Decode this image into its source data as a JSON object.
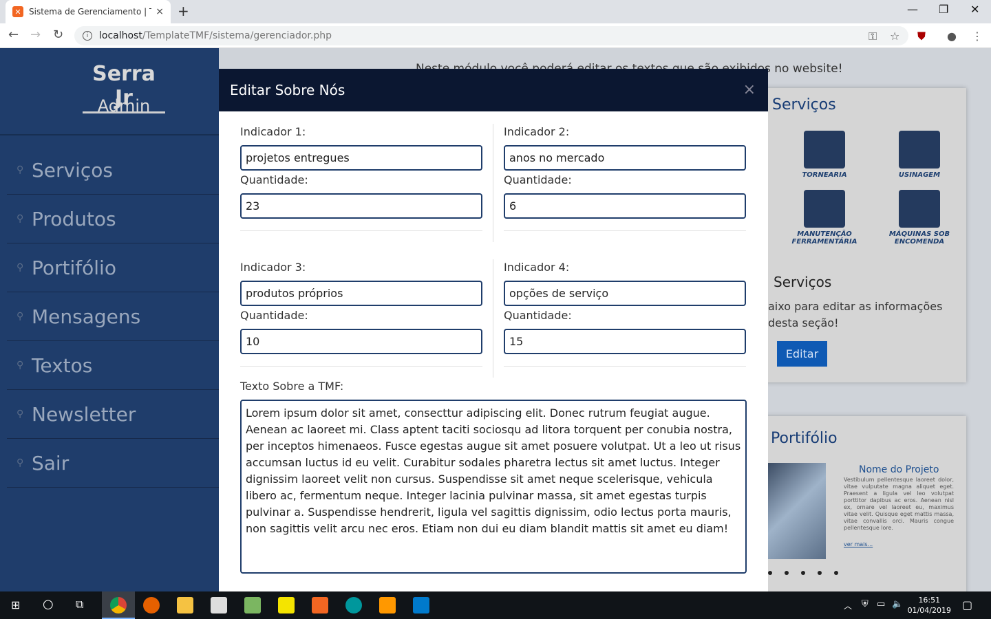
{
  "browser": {
    "tab_title": "Sistema de Gerenciamento | TMF",
    "tab_close": "×",
    "new_tab": "+",
    "url_host": "localhost",
    "url_path": "/TemplateTMF/sistema/gerenciador.php"
  },
  "sidebar": {
    "brand": "Serra Jr",
    "role": "Admin",
    "items": [
      {
        "label": "Serviços"
      },
      {
        "label": "Produtos"
      },
      {
        "label": "Portifólio"
      },
      {
        "label": "Mensagens"
      },
      {
        "label": "Textos"
      },
      {
        "label": "Newsletter"
      },
      {
        "label": "Sair"
      }
    ]
  },
  "background": {
    "intro": "Neste módulo você poderá editar os textos que são exibidos no website!",
    "services_card_title": "Serviços",
    "services": [
      "TORNEARIA",
      "USINAGEM",
      "MANUTENÇÃO FERRAMENTÁRIA",
      "MÁQUINAS SOB ENCOMENDA"
    ],
    "services_heading": "Serviços",
    "services_desc_1": "aixo para editar as informações",
    "services_desc_2": "desta seção!",
    "edit_button": "Editar",
    "portfolio_card_title": "Portifólio",
    "project_name": "Nome do Projeto",
    "project_text": "Vestibulum pellentesque laoreet dolor, vitae vulputate magna aliquet eget. Praesent a ligula vel leo volutpat porttitor dapibus ac eros. Aenean nisl ex, ornare vel laoreet eu, maximus vitae velit. Quisque eget mattis massa, vitae convallis orci. Mauris congue pellentesque lore.",
    "project_more": "ver mais..."
  },
  "modal": {
    "title": "Editar Sobre Nós",
    "close": "×",
    "indicators": [
      {
        "label": "Indicador 1:",
        "value": "projetos entregues",
        "qty_label": "Quantidade:",
        "qty": "23"
      },
      {
        "label": "Indicador 2:",
        "value": "anos no mercado",
        "qty_label": "Quantidade:",
        "qty": "6"
      },
      {
        "label": "Indicador 3:",
        "value": "produtos próprios",
        "qty_label": "Quantidade:",
        "qty": "10"
      },
      {
        "label": "Indicador 4:",
        "value": "opções de serviço",
        "qty_label": "Quantidade:",
        "qty": "15"
      }
    ],
    "text_label": "Texto Sobre a TMF:",
    "text_value": "Lorem ipsum dolor sit amet, consecttur adipiscing elit. Donec rutrum feugiat augue. Aenean ac laoreet mi. Class aptent taciti sociosqu ad litora torquent per conubia nostra, per inceptos himenaeos. Fusce egestas augue sit amet posuere volutpat. Ut a leo ut risus accumsan luctus id eu velit. Curabitur sodales pharetra lectus sit amet luctus. Integer dignissim laoreet velit non cursus. Suspendisse sit amet neque scelerisque, vehicula libero ac, fermentum neque. Integer lacinia pulvinar massa, sit amet egestas turpis pulvinar a. Suspendisse hendrerit, ligula vel sagittis dignissim, odio lectus porta mauris, non sagittis velit arcu nec eros. Etiam non dui eu diam blandit mattis sit amet eu diam!"
  },
  "taskbar": {
    "time": "16:51",
    "date": "01/04/2019"
  }
}
